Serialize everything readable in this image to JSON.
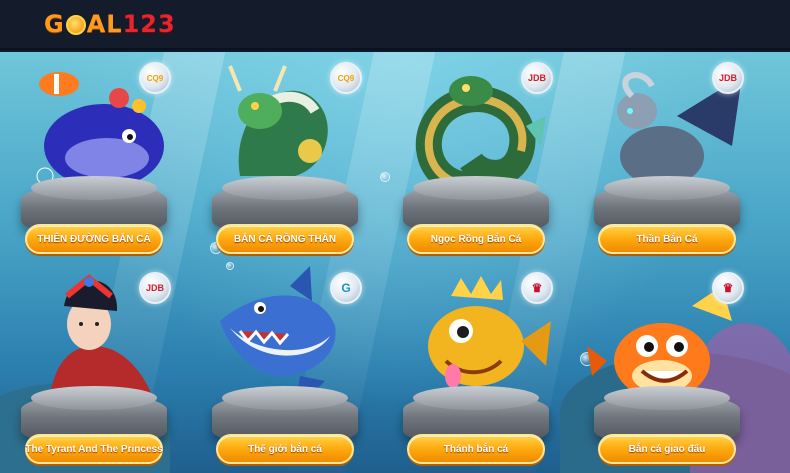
{
  "header": {
    "logo_part1": "G",
    "logo_part2": "AL",
    "logo_part3": "123"
  },
  "colors": {
    "header_bg": "#141c2c",
    "logo_orange": "#ff9a1e",
    "logo_red": "#e8242c",
    "button_gold": "#ffac12",
    "ocean": "#4aa6c8"
  },
  "games": [
    {
      "label": "THIÊN ĐƯỜNG BẮN CÁ",
      "provider_icon": "cq9-logo-icon",
      "provider_text": "CQ9",
      "creature_icon": "whale-fish-icon"
    },
    {
      "label": "BẮN CÁ RỒNG THẦN",
      "provider_icon": "cq9-logo-icon",
      "provider_text": "CQ9",
      "creature_icon": "dragon-icon"
    },
    {
      "label": "Ngọc Rồng Bắn Cá",
      "provider_icon": "jdb-logo-icon",
      "provider_text": "JDB",
      "creature_icon": "green-dragon-icon"
    },
    {
      "label": "Thần Bắn Cá",
      "provider_icon": "jdb-logo-icon",
      "provider_text": "JDB",
      "creature_icon": "winged-beast-icon"
    },
    {
      "label": "The Tyrant And The Princess",
      "provider_icon": "jdb-logo-icon",
      "provider_text": "JDB",
      "creature_icon": "princess-icon"
    },
    {
      "label": "Thế giới bắn cá",
      "provider_icon": "g-logo-icon",
      "provider_text": "G",
      "creature_icon": "shark-icon"
    },
    {
      "label": "Thánh bắn cá",
      "provider_icon": "crown-logo-icon",
      "provider_text": "♛",
      "creature_icon": "golden-fish-icon"
    },
    {
      "label": "Bắn cá giao đấu",
      "provider_icon": "crown-logo-icon",
      "provider_text": "♛",
      "creature_icon": "orange-fish-icon"
    }
  ]
}
